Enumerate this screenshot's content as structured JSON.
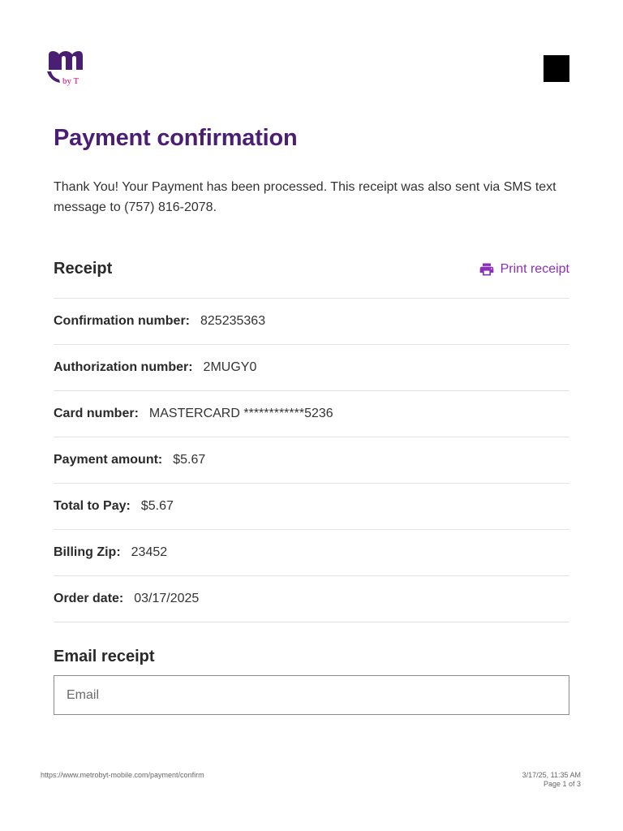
{
  "header": {
    "logo_text": "by T"
  },
  "page_title": "Payment confirmation",
  "intro": "Thank You! Your Payment has been processed. This receipt was also sent via SMS text message to (757) 816-2078.",
  "receipt": {
    "heading": "Receipt",
    "print_label": "Print receipt",
    "rows": [
      {
        "label": "Confirmation number:",
        "value": "825235363"
      },
      {
        "label": "Authorization number:",
        "value": "2MUGY0"
      },
      {
        "label": "Card number:",
        "value": "MASTERCARD ************5236"
      },
      {
        "label": "Payment amount:",
        "value": "$5.67"
      },
      {
        "label": "Total to Pay:",
        "value": "$5.67"
      },
      {
        "label": "Billing Zip:",
        "value": "23452"
      },
      {
        "label": "Order date:",
        "value": "03/17/2025"
      }
    ]
  },
  "email_receipt": {
    "heading": "Email receipt",
    "placeholder": "Email",
    "value": ""
  },
  "footer": {
    "url": "https://www.metrobyt-mobile.com/payment/confirm",
    "datetime": "3/17/25, 11:35 AM",
    "page": "Page 1 of 3"
  },
  "colors": {
    "brand_purple": "#4a1f73",
    "accent_magenta": "#e20074",
    "link_purple": "#8a2fb8"
  },
  "icons": {
    "logo": "metro-by-t-mobile-logo",
    "print": "printer-icon"
  }
}
